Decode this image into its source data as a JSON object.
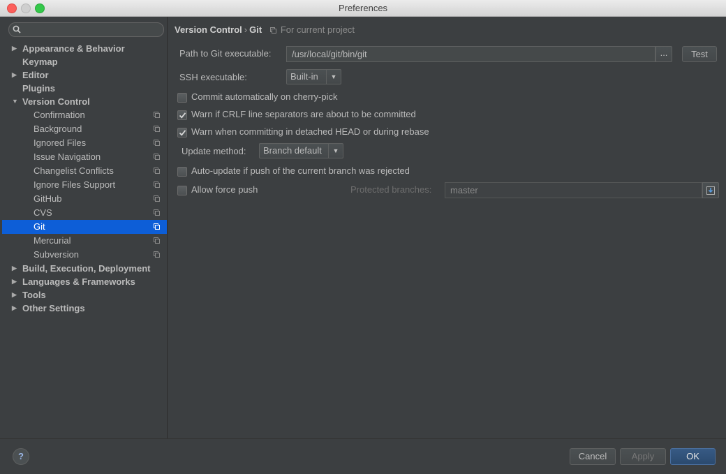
{
  "window": {
    "title": "Preferences"
  },
  "search": {
    "placeholder": ""
  },
  "sidebar": {
    "top_items": [
      {
        "label": "Appearance & Behavior",
        "expanded": false
      },
      {
        "label": "Keymap"
      },
      {
        "label": "Editor",
        "expanded": false
      },
      {
        "label": "Plugins"
      },
      {
        "label": "Version Control",
        "expanded": true
      }
    ],
    "vc_children": [
      "Confirmation",
      "Background",
      "Ignored Files",
      "Issue Navigation",
      "Changelist Conflicts",
      "Ignore Files Support",
      "GitHub",
      "CVS",
      "Git",
      "Mercurial",
      "Subversion"
    ],
    "selected": "Git",
    "bottom_items": [
      {
        "label": "Build, Execution, Deployment"
      },
      {
        "label": "Languages & Frameworks"
      },
      {
        "label": "Tools"
      },
      {
        "label": "Other Settings"
      }
    ]
  },
  "breadcrumb": {
    "parent": "Version Control",
    "separator": "›",
    "current": "Git",
    "scope": "For current project"
  },
  "git": {
    "path_label": "Path to Git executable:",
    "path_value": "/usr/local/git/bin/git",
    "browse_label": "...",
    "test_label": "Test",
    "ssh_label": "SSH executable:",
    "ssh_value": "Built-in",
    "options": [
      {
        "label": "Commit automatically on cherry-pick",
        "checked": false
      },
      {
        "label": "Warn if CRLF line separators are about to be committed",
        "checked": true
      },
      {
        "label": "Warn when committing in detached HEAD or during rebase",
        "checked": true
      }
    ],
    "update_label": "Update method:",
    "update_value": "Branch default",
    "auto_update_label": "Auto-update if push of the current branch was rejected",
    "auto_update_checked": false,
    "force_push_label": "Allow force push",
    "force_push_checked": false,
    "protected_label": "Protected branches:",
    "protected_value": "master"
  },
  "footer": {
    "help": "?",
    "cancel": "Cancel",
    "apply": "Apply",
    "ok": "OK"
  },
  "colors": {
    "background": "#3c3f41",
    "selection": "#0d5ed7",
    "text": "#bbbbbb"
  }
}
